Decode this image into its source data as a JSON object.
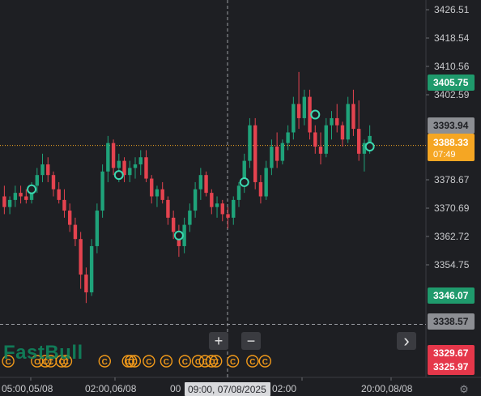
{
  "chart_data": {
    "type": "candlestick",
    "instrument_hint": "XAUUSD",
    "y_axis": {
      "ticks": [
        "3426.51",
        "3418.54",
        "3410.56",
        "3402.59",
        "3378.67",
        "3370.69",
        "3362.72",
        "3354.75"
      ],
      "range": [
        3322,
        3432
      ]
    },
    "x_axis": {
      "labels": [
        "05:00,05/08",
        "02:00,06/08",
        "02:00",
        "20:00,08/08"
      ],
      "crosshair_label": "09:00, 07/08/2025"
    },
    "price_tags": [
      {
        "text": "3405.75",
        "value": 3405.75,
        "color": "#1f9a6c"
      },
      {
        "text": "3393.94",
        "value": 3393.94,
        "color": "#8c8e93"
      },
      {
        "text": "3388.33",
        "value": 3388.33,
        "color": "#f5a623",
        "countdown": "07:49"
      },
      {
        "text": "3346.07",
        "value": 3346.07,
        "color": "#1f9a6c"
      },
      {
        "text": "3338.57",
        "value": 3338.57,
        "color": "#8c8e93"
      },
      {
        "text": "3329.67",
        "value": 3329.67,
        "color": "#e5374a"
      },
      {
        "text": "3325.97",
        "value": 3325.97,
        "color": "#e5374a"
      }
    ],
    "current_price": 3388.33,
    "crosshair_price": 3338.0,
    "colors": {
      "up": "#1fa37a",
      "down": "#e4434f",
      "marker": "#3bd9b0",
      "event": "#f29a1a"
    },
    "grid": false,
    "candles": [
      [
        3374,
        3377,
        3369,
        3371
      ],
      [
        3371,
        3374,
        3369,
        3373
      ],
      [
        3373,
        3377,
        3371,
        3375
      ],
      [
        3375,
        3377,
        3372,
        3374
      ],
      [
        3374,
        3376,
        3372,
        3373
      ],
      [
        3373,
        3378,
        3372,
        3377
      ],
      [
        3377,
        3382,
        3375,
        3380
      ],
      [
        3380,
        3386,
        3378,
        3383
      ],
      [
        3383,
        3385,
        3378,
        3380
      ],
      [
        3380,
        3381,
        3374,
        3376
      ],
      [
        3376,
        3378,
        3372,
        3373
      ],
      [
        3373,
        3376,
        3368,
        3370
      ],
      [
        3370,
        3372,
        3364,
        3366
      ],
      [
        3366,
        3368,
        3360,
        3362
      ],
      [
        3362,
        3364,
        3348,
        3352
      ],
      [
        3352,
        3354,
        3344,
        3347
      ],
      [
        3347,
        3362,
        3346,
        3360
      ],
      [
        3360,
        3372,
        3358,
        3370
      ],
      [
        3370,
        3383,
        3368,
        3381
      ],
      [
        3381,
        3391,
        3378,
        3389
      ],
      [
        3389,
        3390,
        3380,
        3382
      ],
      [
        3382,
        3386,
        3378,
        3384
      ],
      [
        3384,
        3385,
        3378,
        3380
      ],
      [
        3380,
        3384,
        3378,
        3382
      ],
      [
        3382,
        3385,
        3379,
        3383
      ],
      [
        3383,
        3387,
        3380,
        3385
      ],
      [
        3385,
        3387,
        3378,
        3379
      ],
      [
        3379,
        3380,
        3372,
        3374
      ],
      [
        3374,
        3377,
        3371,
        3376
      ],
      [
        3376,
        3378,
        3372,
        3373
      ],
      [
        3373,
        3374,
        3366,
        3368
      ],
      [
        3368,
        3370,
        3362,
        3364
      ],
      [
        3364,
        3366,
        3357,
        3360
      ],
      [
        3360,
        3368,
        3358,
        3366
      ],
      [
        3366,
        3372,
        3364,
        3370
      ],
      [
        3370,
        3378,
        3368,
        3376
      ],
      [
        3376,
        3382,
        3373,
        3380
      ],
      [
        3380,
        3381,
        3374,
        3375
      ],
      [
        3375,
        3376,
        3369,
        3371
      ],
      [
        3371,
        3374,
        3368,
        3372
      ],
      [
        3372,
        3373,
        3367,
        3369
      ],
      [
        3369,
        3371,
        3365,
        3368
      ],
      [
        3368,
        3374,
        3366,
        3373
      ],
      [
        3373,
        3378,
        3371,
        3377
      ],
      [
        3377,
        3386,
        3375,
        3384
      ],
      [
        3384,
        3396,
        3382,
        3394
      ],
      [
        3394,
        3396,
        3376,
        3378
      ],
      [
        3378,
        3380,
        3372,
        3374
      ],
      [
        3374,
        3384,
        3373,
        3382
      ],
      [
        3382,
        3390,
        3380,
        3388
      ],
      [
        3388,
        3392,
        3382,
        3384
      ],
      [
        3384,
        3390,
        3383,
        3389
      ],
      [
        3389,
        3394,
        3387,
        3392
      ],
      [
        3392,
        3402,
        3390,
        3400
      ],
      [
        3400,
        3409,
        3393,
        3396
      ],
      [
        3396,
        3404,
        3394,
        3402
      ],
      [
        3402,
        3404,
        3390,
        3392
      ],
      [
        3392,
        3394,
        3386,
        3388
      ],
      [
        3388,
        3392,
        3383,
        3386
      ],
      [
        3386,
        3396,
        3385,
        3394
      ],
      [
        3394,
        3398,
        3390,
        3396
      ],
      [
        3396,
        3400,
        3392,
        3394
      ],
      [
        3394,
        3395,
        3388,
        3390
      ],
      [
        3390,
        3402,
        3389,
        3400
      ],
      [
        3400,
        3404,
        3391,
        3393
      ],
      [
        3393,
        3401,
        3384,
        3386
      ],
      [
        3386,
        3390,
        3381,
        3389
      ],
      [
        3389,
        3394,
        3386,
        3391
      ]
    ],
    "markers": [
      {
        "index": 5,
        "value": 3376
      },
      {
        "index": 21,
        "value": 3380
      },
      {
        "index": 32,
        "value": 3363
      },
      {
        "index": 44,
        "value": 3378
      },
      {
        "index": 57,
        "value": 3397
      },
      {
        "index": 67,
        "value": 3388
      }
    ],
    "event_icons": {
      "glyph": "C",
      "slots": [
        1.2,
        6.5,
        8.0,
        9.0,
        11.0,
        11.8,
        18.9,
        23.2,
        23.7,
        24.4,
        27.0,
        30.2,
        33.6,
        36.0,
        37.3,
        38.5,
        39.3,
        42.4,
        46.0,
        48.3
      ]
    }
  },
  "logo_text": "FastBull",
  "controls": {
    "zoom_in": "+",
    "zoom_out": "−",
    "next": "›"
  },
  "settings_icon": "⚙"
}
